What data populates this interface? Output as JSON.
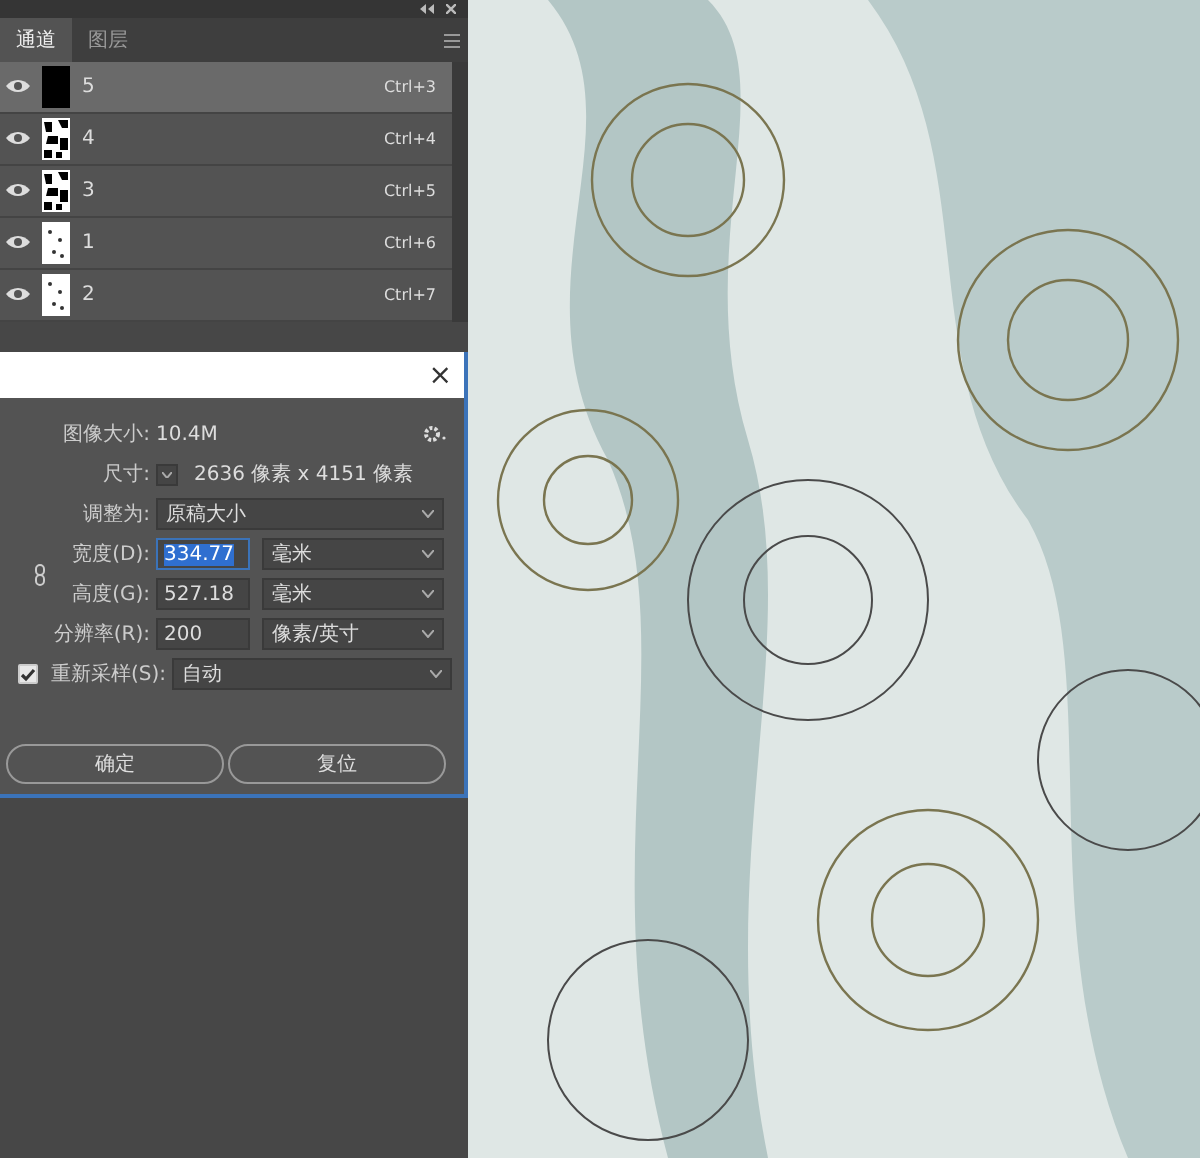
{
  "panel": {
    "tabs": [
      {
        "label": "通道",
        "selected": true
      },
      {
        "label": "图层",
        "selected": false
      }
    ],
    "channels": [
      {
        "name": "5",
        "shortcut": "Ctrl+3",
        "visible": true,
        "selected": true,
        "kind": "solid"
      },
      {
        "name": "4",
        "shortcut": "Ctrl+4",
        "visible": true,
        "selected": false,
        "kind": "dense"
      },
      {
        "name": "3",
        "shortcut": "Ctrl+5",
        "visible": true,
        "selected": false,
        "kind": "dense"
      },
      {
        "name": "1",
        "shortcut": "Ctrl+6",
        "visible": true,
        "selected": false,
        "kind": "sparse"
      },
      {
        "name": "2",
        "shortcut": "Ctrl+7",
        "visible": true,
        "selected": false,
        "kind": "sparse"
      }
    ]
  },
  "dialog": {
    "close": "×",
    "image_size": {
      "label": "图像大小:",
      "value": "10.4M"
    },
    "dimensions": {
      "label": "尺寸:",
      "value": "2636 像素 x 4151 像素"
    },
    "fit_to": {
      "label": "调整为:",
      "value": "原稿大小"
    },
    "fields": [
      {
        "label": "宽度(D):",
        "value": "334.77",
        "unit": "毫米",
        "text_selected": true
      },
      {
        "label": "高度(G):",
        "value": "527.18",
        "unit": "毫米",
        "text_selected": false
      },
      {
        "label": "分辨率(R):",
        "value": "200",
        "unit": "像素/英寸",
        "text_selected": false
      }
    ],
    "resample": {
      "label": "重新采样(S):",
      "checked": true,
      "value": "自动"
    },
    "buttons": [
      "确定",
      "复位"
    ]
  }
}
